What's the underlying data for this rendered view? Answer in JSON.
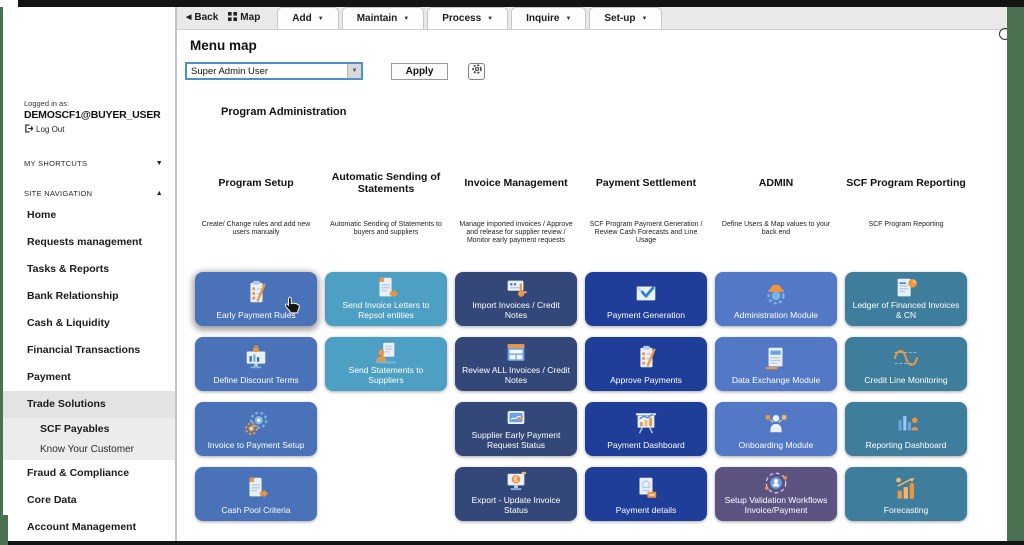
{
  "colors": {
    "select_border": "#4e8fd0",
    "side_strip_green": "#4a7150",
    "tile_program_setup": "#4a72b8",
    "tile_statements": "#4d9fc4",
    "tile_invoice_mgmt": "#334878",
    "tile_payment_settlement": "#1e3e99",
    "tile_admin": "#5379c6",
    "tile_admin_purple": "#5d5383",
    "tile_reporting": "#3e7e9c"
  },
  "topbar": {
    "back_label": "Back",
    "map_label": "Map",
    "menus": [
      {
        "label": "Add"
      },
      {
        "label": "Maintain"
      },
      {
        "label": "Process"
      },
      {
        "label": "Inquire"
      },
      {
        "label": "Set-up"
      }
    ]
  },
  "page": {
    "title": "Menu map",
    "role_select": {
      "value": "Super Admin User"
    },
    "apply_label": "Apply",
    "section_title": "Program Administration"
  },
  "sidebar": {
    "logged_in_label": "Logged in as:",
    "username": "DEMOSCF1@BUYER_USER",
    "logout_label": "Log Out",
    "shortcuts_label": "MY SHORTCUTS",
    "site_nav_label": "SITE NAVIGATION",
    "items": [
      {
        "label": "Home"
      },
      {
        "label": "Requests management"
      },
      {
        "label": "Tasks & Reports"
      },
      {
        "label": "Bank Relationship"
      },
      {
        "label": "Cash & Liquidity"
      },
      {
        "label": "Financial Transactions"
      },
      {
        "label": "Payment"
      },
      {
        "label": "Trade Solutions",
        "selected": true
      },
      {
        "label": "SCF Payables",
        "child": true,
        "selected": true
      },
      {
        "label": "Know Your Customer",
        "child": true,
        "regular": true,
        "selected": true
      },
      {
        "label": "Fraud & Compliance"
      },
      {
        "label": "Core Data"
      },
      {
        "label": "Account Management"
      }
    ]
  },
  "board": {
    "columns": [
      {
        "title": "Program Setup",
        "description": "Create/ Change rules and add new users manually",
        "tiles": [
          {
            "label": "Early Payment Rules",
            "icon": "clipboard-pencil-icon",
            "color": "#4a72b8",
            "hovered": true
          },
          {
            "label": "Define Discount Terms",
            "icon": "monitor-lock-icon",
            "color": "#4a72b8"
          },
          {
            "label": "Invoice to Payment Setup",
            "icon": "gears-icon",
            "color": "#4a72b8"
          },
          {
            "label": "Cash Pool Criteria",
            "icon": "document-arrow-icon",
            "color": "#4a72b8"
          }
        ]
      },
      {
        "title": "Automatic Sending of Statements",
        "description": "Automatic Sending of Statements to buyers and suppliers",
        "tiles": [
          {
            "label": "Send Invoice Letters to Repsol entities",
            "icon": "document-arrow-icon",
            "color": "#4d9fc4"
          },
          {
            "label": "Send Statements to Suppliers",
            "icon": "person-document-icon",
            "color": "#4d9fc4"
          }
        ]
      },
      {
        "title": "Invoice Management",
        "description": "Manage imported invoices / Approve and release for supplier review / Monitor early payment requests",
        "tiles": [
          {
            "label": "Import Invoices / Credit Notes",
            "icon": "card-hand-icon",
            "color": "#334878"
          },
          {
            "label": "Review ALL Invoices / Credit Notes",
            "icon": "browser-window-icon",
            "color": "#334878"
          },
          {
            "label": "Supplier Early Payment Request Status",
            "icon": "id-card-icon",
            "color": "#334878"
          },
          {
            "label": "Export - Update Invoice Status",
            "icon": "monitor-euro-icon",
            "color": "#334878"
          }
        ]
      },
      {
        "title": "Payment Settlement",
        "description": "SCF Program Payment Generation / Review Cash Forecasts and Line Usage",
        "tiles": [
          {
            "label": "Payment Generation",
            "icon": "envelope-check-icon",
            "color": "#1e3e99"
          },
          {
            "label": "Approve Payments",
            "icon": "clipboard-pencil-icon",
            "color": "#1e3e99"
          },
          {
            "label": "Payment Dashboard",
            "icon": "presentation-chart-icon",
            "color": "#1e3e99"
          },
          {
            "label": "Payment details",
            "icon": "certificate-icon",
            "color": "#1e3e99"
          }
        ]
      },
      {
        "title": "ADMIN",
        "description": "Define Users & Map values to your back end",
        "tiles": [
          {
            "label": "Administration Module",
            "icon": "gear-hardhat-icon",
            "color": "#5379c6"
          },
          {
            "label": "Data Exchange Module",
            "icon": "document-lines-icon",
            "color": "#5379c6"
          },
          {
            "label": "Onboarding Module",
            "icon": "person-thumbs-icon",
            "color": "#5379c6"
          },
          {
            "label": "Setup Validation Workflows Invoice/Payment",
            "icon": "person-orbit-icon",
            "color": "#5d5383"
          }
        ]
      },
      {
        "title": "SCF Program Reporting",
        "description": "SCF Program Reporting",
        "tiles": [
          {
            "label": "Ledger of Financed Invoices & CN",
            "icon": "document-chart-icon",
            "color": "#3e7e9c"
          },
          {
            "label": "Credit Line Monitoring",
            "icon": "wave-icon",
            "color": "#3e7e9c"
          },
          {
            "label": "Reporting Dashboard",
            "icon": "barchart-person-icon",
            "color": "#3e7e9c"
          },
          {
            "label": "Forecasting",
            "icon": "barchart-up-icon",
            "color": "#3e7e9c"
          }
        ]
      }
    ]
  }
}
